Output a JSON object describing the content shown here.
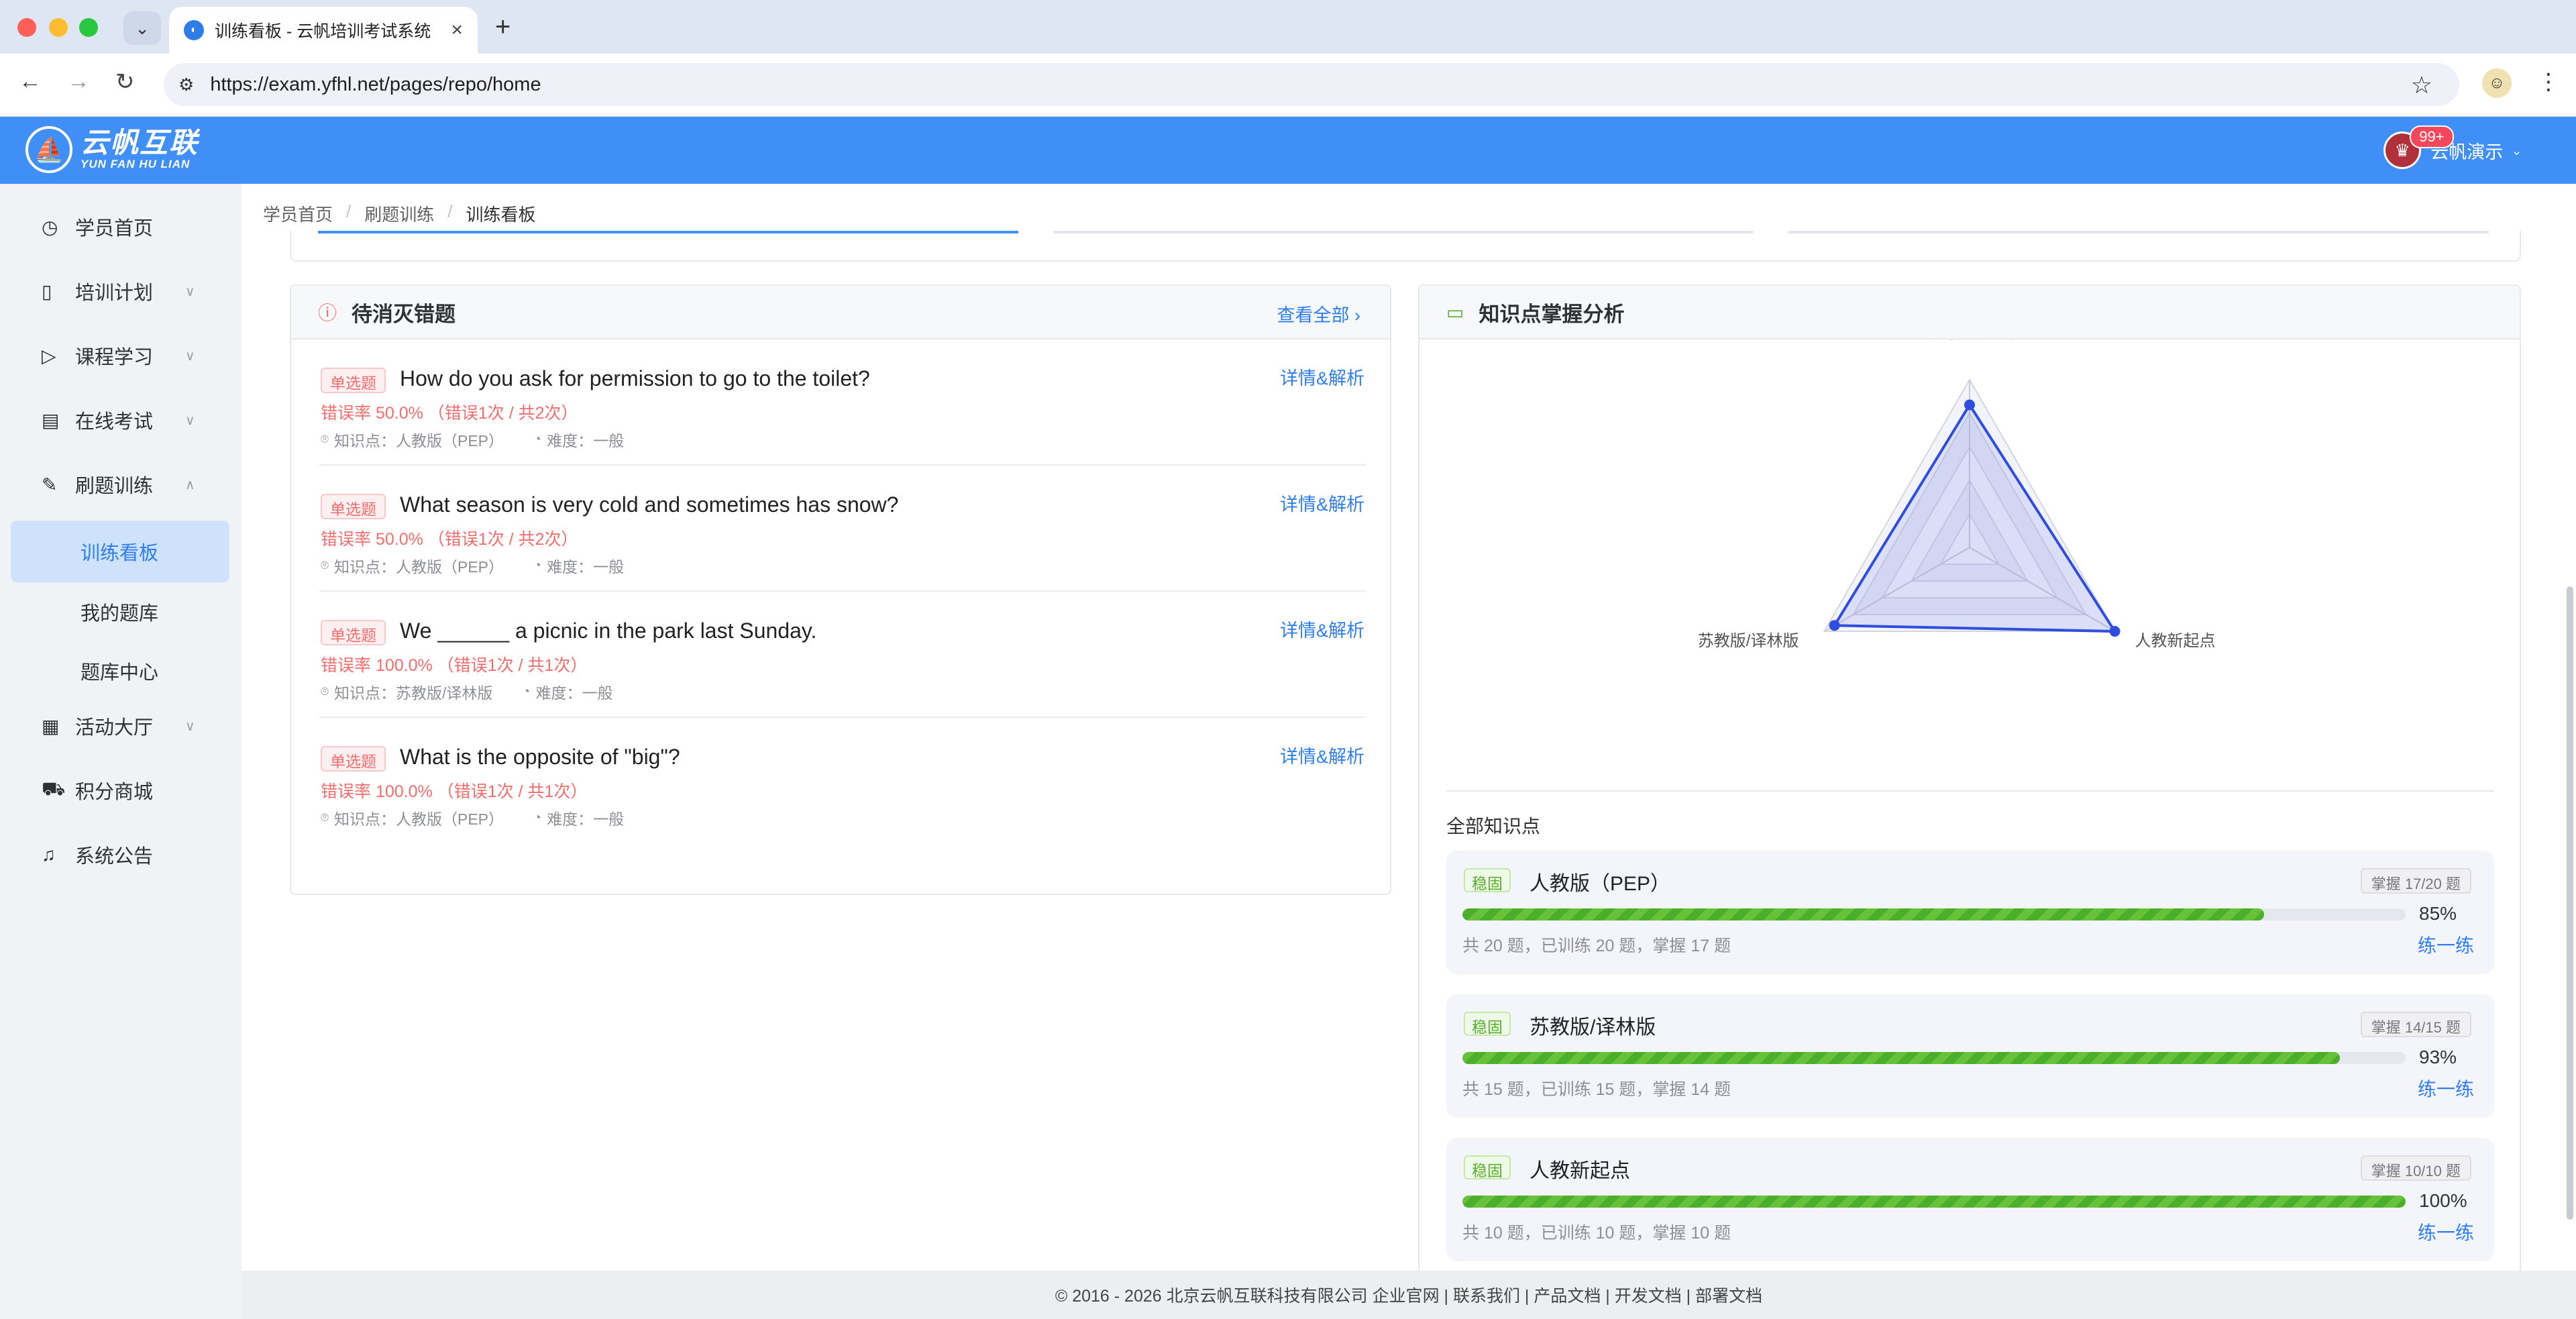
{
  "browser": {
    "tab_title": "训练看板 - 云帆培训考试系统",
    "url": "https://exam.yfhl.net/pages/repo/home"
  },
  "header": {
    "logo_cn": "云帆互联",
    "logo_en": "YUN FAN HU LIAN",
    "badge": "99+",
    "user_name": "云帆演示",
    "accent_color": "#3f8ff7"
  },
  "sidebar": {
    "items": [
      {
        "label": "学员首页",
        "icon": "dashboard-icon"
      },
      {
        "label": "培训计划",
        "icon": "book-icon"
      },
      {
        "label": "课程学习",
        "icon": "play-icon"
      },
      {
        "label": "在线考试",
        "icon": "exam-icon"
      },
      {
        "label": "刷题训练",
        "icon": "pen-icon"
      },
      {
        "label": "活动大厅",
        "icon": "calendar-icon"
      },
      {
        "label": "积分商城",
        "icon": "cart-icon"
      },
      {
        "label": "系统公告",
        "icon": "bell-icon"
      }
    ],
    "sub_items": [
      "训练看板",
      "我的题库",
      "题库中心"
    ]
  },
  "breadcrumb": [
    "学员首页",
    "刷题训练",
    "训练看板"
  ],
  "wrong_questions": {
    "title": "待消灭错题",
    "view_all": "查看全部",
    "items": [
      {
        "type": "单选题",
        "text": "How do you ask for permission to go to the toilet?",
        "rate": "错误率 50.0% （错误1次 / 共2次）",
        "knowledge": "知识点：人教版（PEP）",
        "difficulty": "难度：一般",
        "detail": "详情&解析"
      },
      {
        "type": "单选题",
        "text": "What season is very cold and sometimes has snow?",
        "rate": "错误率 50.0% （错误1次 / 共2次）",
        "knowledge": "知识点：人教版（PEP）",
        "difficulty": "难度：一般",
        "detail": "详情&解析"
      },
      {
        "type": "单选题",
        "text": "We ______ a picnic in the park last Sunday.",
        "rate": "错误率 100.0% （错误1次 / 共1次）",
        "knowledge": "知识点：苏教版/译林版",
        "difficulty": "难度：一般",
        "detail": "详情&解析"
      },
      {
        "type": "单选题",
        "text": "What is the opposite of \"big\"?",
        "rate": "错误率 100.0% （错误1次 / 共1次）",
        "knowledge": "知识点：人教版（PEP）",
        "difficulty": "难度：一般",
        "detail": "详情&解析"
      }
    ]
  },
  "knowledge": {
    "title": "知识点掌握分析",
    "all_label": "全部知识点",
    "items": [
      {
        "tag": "稳固",
        "name": "人教版（PEP）",
        "master": "掌握 17/20 题",
        "percent": 85,
        "percent_label": "85%",
        "stat": "共 20 题，已训练 20 题，掌握 17 题",
        "practice": "练一练"
      },
      {
        "tag": "稳固",
        "name": "苏教版/译林版",
        "master": "掌握 14/15 题",
        "percent": 93,
        "percent_label": "93%",
        "stat": "共 15 题，已训练 15 题，掌握 14 题",
        "practice": "练一练"
      },
      {
        "tag": "稳固",
        "name": "人教新起点",
        "master": "掌握 10/10 题",
        "percent": 100,
        "percent_label": "100%",
        "stat": "共 10 题，已训练 10 题，掌握 10 题",
        "practice": "练一练"
      }
    ]
  },
  "chart_data": {
    "type": "radar",
    "categories": [
      "人教版（PEP）",
      "人教新起点",
      "苏教版/译林版"
    ],
    "values": [
      85,
      100,
      93
    ],
    "max": 100,
    "color": "#2f4ee0"
  },
  "footer": {
    "text": "© 2016 - 2026 北京云帆互联科技有限公司 企业官网 | 联系我们 | 产品文档 | 开发文档 | 部署文档"
  }
}
